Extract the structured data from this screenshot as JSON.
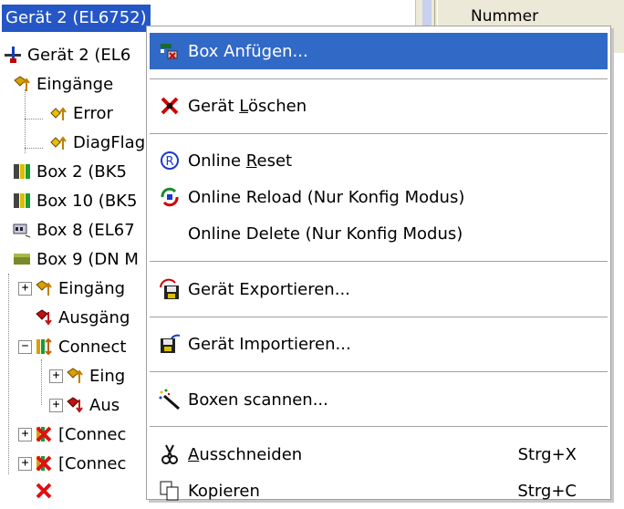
{
  "tree": {
    "selected_label": "Gerät 2 (EL6752)",
    "rows": [
      {
        "label": "Gerät 2 (EL6"
      },
      {
        "label": "Eingänge"
      },
      {
        "label": "Error"
      },
      {
        "label": "DiagFlag"
      },
      {
        "label": "Box 2  (BK5"
      },
      {
        "label": "Box 10  (BK5"
      },
      {
        "label": "Box 8 (EL67"
      },
      {
        "label": "Box 9 (DN M"
      },
      {
        "label": "Eingäng"
      },
      {
        "label": "Ausgäng"
      },
      {
        "label": "Connect"
      },
      {
        "label": "Eing"
      },
      {
        "label": "Aus"
      },
      {
        "label": "[Connec"
      },
      {
        "label": "[Connec"
      }
    ],
    "expander_plus": "+",
    "expander_minus": "−"
  },
  "list_header": {
    "column_label": "Nummer"
  },
  "context_menu": {
    "items": [
      {
        "label": "Box Anfügen...",
        "icon": "add-box-icon"
      },
      {
        "label_pre": "Gerät ",
        "label_ul": "L",
        "label_post": "öschen",
        "icon": "delete-x-icon"
      },
      {
        "label_pre": "Online ",
        "label_ul": "R",
        "label_post": "eset",
        "icon": "reset-r-icon"
      },
      {
        "label": "Online Reload (Nur Konfig Modus)",
        "icon": "reload-icon"
      },
      {
        "label": "Online Delete (Nur Konfig Modus)",
        "icon": ""
      },
      {
        "label": "Gerät Exportieren...",
        "icon": "export-disk-icon"
      },
      {
        "label": "Gerät Importieren...",
        "icon": "import-disk-icon"
      },
      {
        "label": "Boxen scannen...",
        "icon": "magic-wand-icon"
      },
      {
        "label_pre": "",
        "label_ul": "A",
        "label_post": "usschneiden",
        "shortcut": "Strg+X",
        "icon": "scissors-icon"
      },
      {
        "label": "Kopieren",
        "shortcut": "Strg+C",
        "icon": "copy-icon"
      }
    ]
  },
  "colors": {
    "selection": "#2556c6",
    "menu_highlight": "#3169c6",
    "header_bg": "#ece9d8"
  }
}
